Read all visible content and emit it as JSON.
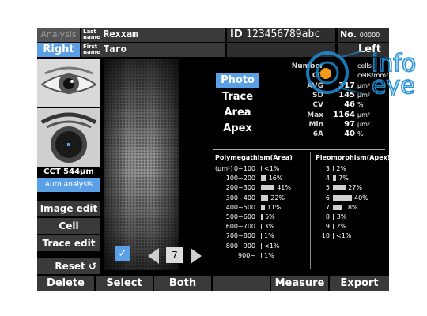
{
  "header": {
    "analysis_label": "Analysis",
    "last_name_label": "Last name",
    "first_name_label": "First name",
    "last_name": "Rexxam",
    "first_name": "Taro",
    "eye_button": "Right",
    "id_label": "ID",
    "id_value": "123456789abc",
    "no_label": "No.",
    "no_value": "00000",
    "side": "Left"
  },
  "left_panel": {
    "cct_label": "CCT",
    "cct_value": "544μm",
    "auto_analysis": "Auto analysis",
    "image_edit": "Image edit",
    "cell_remove": "Cell remove",
    "trace_edit": "Trace edit",
    "reset": "Reset",
    "page": "7"
  },
  "modes": [
    "Photo",
    "Trace",
    "Area",
    "Apex"
  ],
  "stats": [
    {
      "label": "Number",
      "value": "",
      "unit": "cells"
    },
    {
      "label": "CD",
      "value": "",
      "unit": "cells/mm²"
    },
    {
      "label": "AVG",
      "value": "317",
      "unit": "μm²"
    },
    {
      "label": "SD",
      "value": "145",
      "unit": "μm²"
    },
    {
      "label": "CV",
      "value": "46",
      "unit": "%"
    },
    {
      "label": "Max",
      "value": "1164",
      "unit": "μm²"
    },
    {
      "label": "Min",
      "value": "97",
      "unit": "μm²"
    },
    {
      "label": "6A",
      "value": "40",
      "unit": "%"
    }
  ],
  "polymegathism": {
    "title": "Polymegathism(Area)",
    "unit": "(μm²)",
    "rows": [
      {
        "range": "0~100",
        "pct": "<1%",
        "value": 0.5
      },
      {
        "range": "100~200",
        "pct": "16%",
        "value": 16
      },
      {
        "range": "200~300",
        "pct": "41%",
        "value": 41
      },
      {
        "range": "300~400",
        "pct": "22%",
        "value": 22
      },
      {
        "range": "400~500",
        "pct": "11%",
        "value": 11
      },
      {
        "range": "500~600",
        "pct": "5%",
        "value": 5
      },
      {
        "range": "600~700",
        "pct": "3%",
        "value": 3
      },
      {
        "range": "700~800",
        "pct": "1%",
        "value": 1
      },
      {
        "range": "800~900",
        "pct": "<1%",
        "value": 0.5
      },
      {
        "range": "900~",
        "pct": "1%",
        "value": 1
      }
    ]
  },
  "pleomorphism": {
    "title": "Pleomorphism(Apex)",
    "rows": [
      {
        "apex": "3",
        "pct": "2%",
        "value": 2
      },
      {
        "apex": "4",
        "pct": "7%",
        "value": 7
      },
      {
        "apex": "5",
        "pct": "27%",
        "value": 27
      },
      {
        "apex": "6",
        "pct": "40%",
        "value": 40
      },
      {
        "apex": "7",
        "pct": "18%",
        "value": 18
      },
      {
        "apex": "8",
        "pct": "3%",
        "value": 3
      },
      {
        "apex": "9",
        "pct": "2%",
        "value": 2
      },
      {
        "apex": "10",
        "pct": "<1%",
        "value": 0.5
      }
    ]
  },
  "footer": [
    "Delete",
    "Select",
    "Both eyes",
    "",
    "Measure",
    "Export"
  ],
  "watermark": {
    "line1": "info",
    "line2": "eye"
  },
  "colors": {
    "accent": "#5aa0e6",
    "panel": "#3a3a3a",
    "logo": "#1e8fd6",
    "logo_dot": "#f29b1d"
  }
}
